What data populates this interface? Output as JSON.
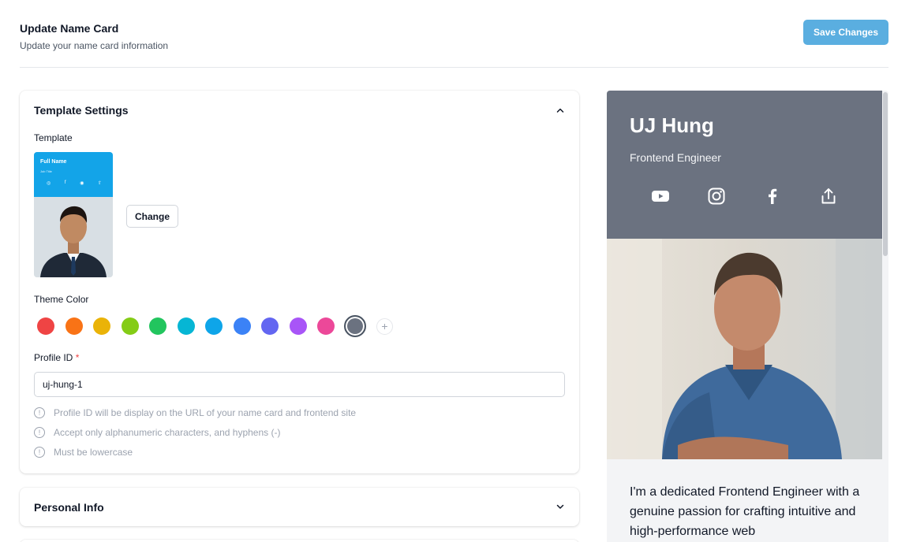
{
  "header": {
    "title": "Update Name Card",
    "subtitle": "Update your name card information",
    "save_label": "Save Changes"
  },
  "template_settings": {
    "title": "Template Settings",
    "template_label": "Template",
    "thumbnail": {
      "name": "Full Name",
      "job": "Job Title"
    },
    "change_label": "Change",
    "theme_label": "Theme Color",
    "theme_colors": [
      "#ef4444",
      "#f97316",
      "#eab308",
      "#84cc16",
      "#22c55e",
      "#06b6d4",
      "#0ea5e9",
      "#3b82f6",
      "#6366f1",
      "#a855f7",
      "#ec4899",
      "#6b7280"
    ],
    "selected_color": "#6b7280",
    "profile_label": "Profile ID",
    "required_mark": "*",
    "profile_value": "uj-hung-1",
    "hints": [
      "Profile ID will be display on the URL of your name card and frontend site",
      "Accept only alphanumeric characters, and hyphens (-)",
      "Must be lowercase"
    ]
  },
  "personal_info": {
    "title": "Personal Info"
  },
  "preview": {
    "name": "UJ Hung",
    "job": "Frontend Engineer",
    "social_icons": [
      "youtube-icon",
      "instagram-icon",
      "facebook-icon",
      "share-icon"
    ],
    "bio": "I'm a dedicated Frontend Engineer with a genuine passion for crafting intuitive and high-performance web"
  }
}
